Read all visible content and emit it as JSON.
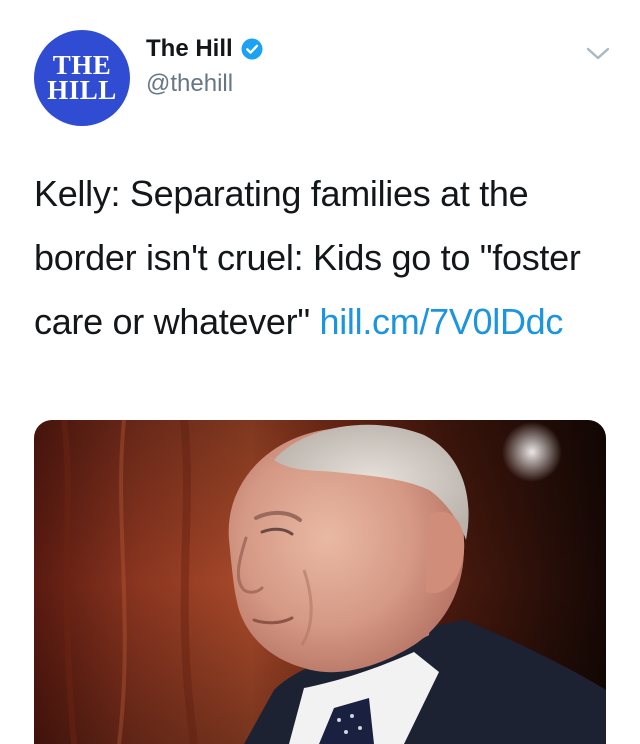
{
  "account": {
    "avatar_line1": "THE",
    "avatar_line2": "HILL",
    "display_name": "The Hill",
    "handle": "@thehill",
    "verified": true
  },
  "tweet": {
    "text": "Kelly: Separating families at the border isn't cruel: Kids go to \"foster care or whatever\" ",
    "link_text": "hill.cm/7V0lDdc"
  },
  "icons": {
    "verified": "verified-badge-icon",
    "menu": "chevron-down-icon"
  },
  "colors": {
    "link": "#1b95e0",
    "avatar_bg": "#2f4cd3",
    "verified": "#1da1f2",
    "handle": "#657786"
  }
}
